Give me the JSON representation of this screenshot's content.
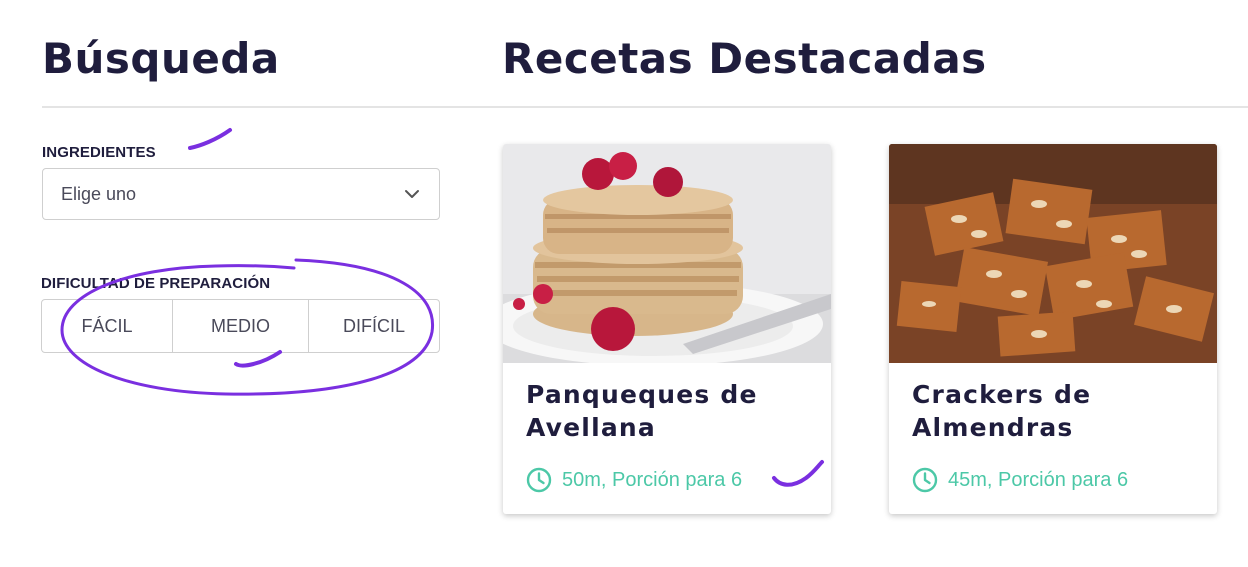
{
  "sidebar": {
    "title": "Búsqueda",
    "ingredients": {
      "label": "INGREDIENTES",
      "placeholder": "Elige uno",
      "icon": "chevron-down-icon"
    },
    "difficulty": {
      "label": "DIFICULTAD DE PREPARACIÓN",
      "options": [
        "FÁCIL",
        "MEDIO",
        "DIFÍCIL"
      ]
    }
  },
  "main": {
    "title": "Recetas Destacadas",
    "recipes": [
      {
        "title": "Panqueques de Avellana",
        "meta": "50m, Porción para 6",
        "icon": "clock-icon"
      },
      {
        "title": "Crackers  de Almendras",
        "meta": "45m, Porción para 6",
        "icon": "clock-icon"
      }
    ]
  },
  "colors": {
    "heading": "#1f1d3d",
    "accent_teal": "#4cc8a7",
    "annotation_purple": "#7a2fe0"
  }
}
